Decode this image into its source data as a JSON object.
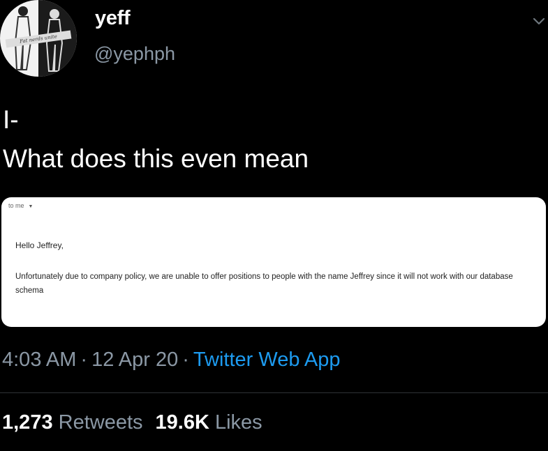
{
  "user": {
    "display_name": "yeff",
    "handle": "@yephph",
    "avatar_banner_text": "Fat nerds unite"
  },
  "tweet": {
    "text": "I-\nWhat does this even mean"
  },
  "email_card": {
    "recipient": "to me",
    "greeting": "Hello Jeffrey,",
    "body": "Unfortunately due to company policy, we are unable to offer positions to people with the name Jeffrey since it will not work with our database schema"
  },
  "meta": {
    "time": "4:03 AM",
    "date": "12 Apr 20",
    "source": "Twitter Web App"
  },
  "stats": {
    "retweets_count": "1,273",
    "retweets_label": "Retweets",
    "likes_count": "19.6K",
    "likes_label": "Likes"
  },
  "colors": {
    "background": "#000000",
    "secondary_text": "#8b98a5",
    "accent": "#1d9bf0"
  }
}
